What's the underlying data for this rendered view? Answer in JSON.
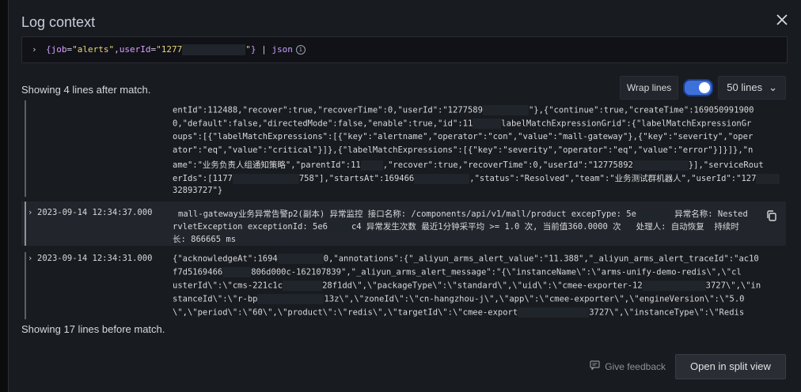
{
  "dialog": {
    "title": "Log context",
    "close_icon": "close-icon"
  },
  "query": {
    "prefix": "{",
    "key1": "job",
    "eq1": "=",
    "val1": "\"alerts\"",
    "comma": ",",
    "key2": "userId",
    "eq2": "=",
    "val2": "\"1277",
    "val2_end": "\"",
    "suffix": "}",
    "pipe": " | ",
    "parser": "json"
  },
  "after_text": "Showing 4 lines after match.",
  "before_text": "Showing 17 lines before match.",
  "controls": {
    "wrap_label": "Wrap lines",
    "wrap_enabled": true,
    "lines_select": "50 lines"
  },
  "logs": {
    "block1": [
      "entId\":112488,\"recover\":true,\"recoverTime\":0,\"userId\":\"1277589",
      "0,\"default\":false,\"directedMode\":false,\"enable\":true,\"id\":11",
      "oups\":[{\"labelMatchExpressions\":[{\"key\":\"alertname\",\"operator\":\"con\",\"value\":\"mall-gateway\"},{\"key\":\"severity\",\"oper",
      "ator\":\"eq\",\"value\":\"critical\"}]},{\"labelMatchExpressions\":[{\"key\":\"severity\",\"operator\":\"eq\",\"value\":\"error\"}]}]},\"n",
      "ame\":\"业务负责人组通知策略\",\"parentId\":11",
      "erIds\":[1177",
      "32893727\"}"
    ],
    "block1_tails": [
      "\"},{\"continue\":true,\"createTime\":169050991900",
      "labelMatchExpressionGrid\":{\"labelMatchExpressionGr",
      "",
      "",
      ",\"recover\":true,\"recoverTime\":0,\"userId\":\"12775892",
      "758\"],\"startsAt\":169466",
      ""
    ],
    "block1_line5_tail": "}],\"serviceRout",
    "block1_line6_tail": ",\"status\":\"Resolved\",\"team\":\"业务测试群机器人\",\"userId\":\"127",
    "block2": {
      "timestamp": "2023-09-14 12:34:37.000",
      "line1a": "mall-gateway业务异常告警p2(副本) 异常监控 接口名称: /components/api/v1/mall/product excepType: 5e",
      "line1b": "异常名称: Nested",
      "line2a": "rvletException exceptionId: 5e6",
      "line2b": "c4 异常发生次数 最近1分钟采平均 >= 1.0 次, 当前值360.0000 次   处理人: 自动恢复  持续时",
      "line3": "长: 866665 ms"
    },
    "block3": {
      "timestamp": "2023-09-14 12:34:31.000",
      "line1a": "{\"acknowledgeAt\":1694",
      "line1b": "0,\"annotations\":{\"_aliyun_arms_alert_value\":\"11.388\",\"_aliyun_arms_alert_traceId\":\"ac10",
      "line2a": "f7d5169466",
      "line2b": "806d000c-162107839\",\"_aliyun_arms_alert_message\":\"{\\\"instanceName\\\":\\\"arms-unify-demo-redis\\\",\\\"cl",
      "line3a": "usterId\\\":\\\"cms-221c1c",
      "line3b": "28f1dd\\\",\\\"packageType\\\":\\\"standard\\\",\\\"uid\\\":\\\"cmee-exporter-12",
      "line3c": "3727\\\",\\\"in",
      "line4a": "stanceId\\\":\\\"r-bp",
      "line4b": "13z\\\",\\\"zoneId\\\":\\\"cn-hangzhou-j\\\",\\\"app\\\":\\\"cmee-exporter\\\",\\\"engineVersion\\\":\\\"5.0",
      "line5a": "\\\",\\\"period\\\":\\\"60\\\",\\\"product\\\":\\\"redis\\\",\\\"targetId\\\":\\\"cmee-export",
      "line5b": "3727\\\",\\\"instanceType\\\":\\\"Redis"
    }
  },
  "footer": {
    "feedback": "Give feedback",
    "split_view": "Open in split view"
  }
}
